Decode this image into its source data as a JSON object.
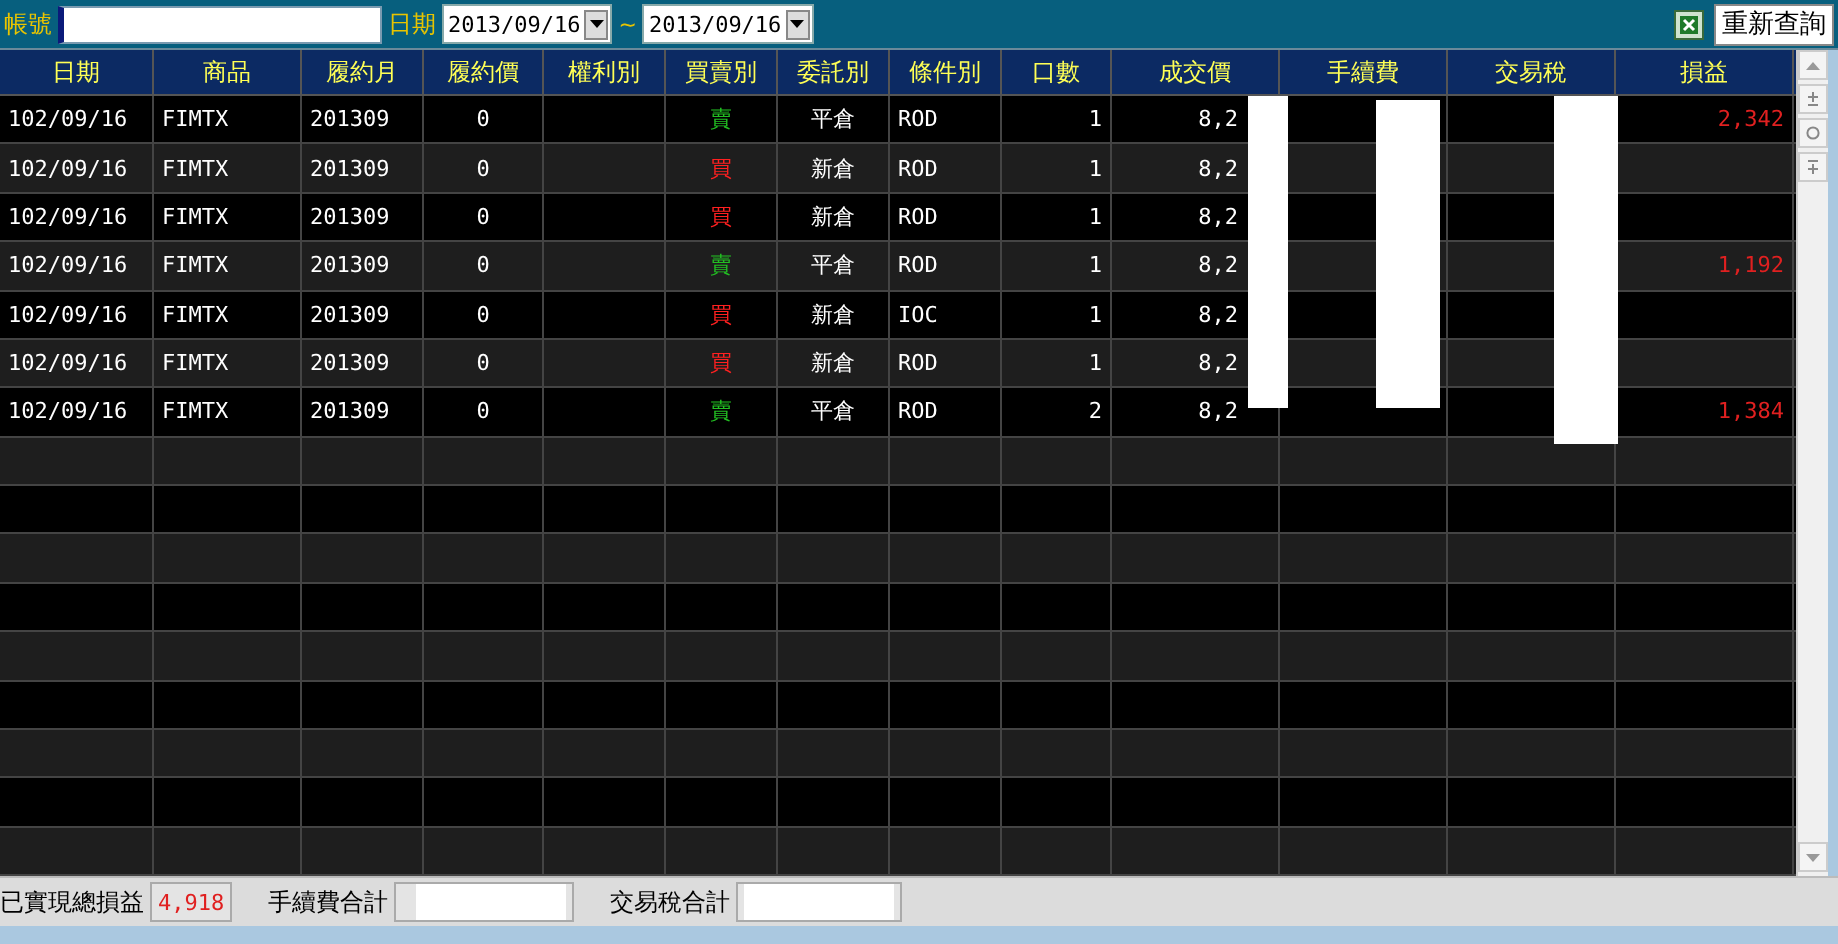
{
  "toolbar": {
    "account_label": "帳號",
    "date_label": "日期",
    "date_from": "2013/09/16",
    "date_separator": "~",
    "date_to": "2013/09/16",
    "requery_button": "重新查詢"
  },
  "table": {
    "columns": [
      "日期",
      "商品",
      "履約月",
      "履約價",
      "權利別",
      "買賣別",
      "委託別",
      "條件別",
      "口數",
      "成交價",
      "手續費",
      "交易稅",
      "損益"
    ],
    "rows": [
      {
        "date": "102/09/16",
        "product": "FIMTX",
        "month": "201309",
        "strike": "0",
        "right": "",
        "side": {
          "text": "賣",
          "kind": "sell"
        },
        "order": "平倉",
        "cond": "ROD",
        "qty": "1",
        "price": "8,2",
        "fee": "",
        "tax": "",
        "pnl": "2,342"
      },
      {
        "date": "102/09/16",
        "product": "FIMTX",
        "month": "201309",
        "strike": "0",
        "right": "",
        "side": {
          "text": "買",
          "kind": "buy"
        },
        "order": "新倉",
        "cond": "ROD",
        "qty": "1",
        "price": "8,2",
        "fee": "",
        "tax": "",
        "pnl": ""
      },
      {
        "date": "102/09/16",
        "product": "FIMTX",
        "month": "201309",
        "strike": "0",
        "right": "",
        "side": {
          "text": "買",
          "kind": "buy"
        },
        "order": "新倉",
        "cond": "ROD",
        "qty": "1",
        "price": "8,2",
        "fee": "",
        "tax": "",
        "pnl": ""
      },
      {
        "date": "102/09/16",
        "product": "FIMTX",
        "month": "201309",
        "strike": "0",
        "right": "",
        "side": {
          "text": "賣",
          "kind": "sell"
        },
        "order": "平倉",
        "cond": "ROD",
        "qty": "1",
        "price": "8,2",
        "fee": "",
        "tax": "",
        "pnl": "1,192"
      },
      {
        "date": "102/09/16",
        "product": "FIMTX",
        "month": "201309",
        "strike": "0",
        "right": "",
        "side": {
          "text": "買",
          "kind": "buy"
        },
        "order": "新倉",
        "cond": "IOC",
        "qty": "1",
        "price": "8,2",
        "fee": "",
        "tax": "",
        "pnl": ""
      },
      {
        "date": "102/09/16",
        "product": "FIMTX",
        "month": "201309",
        "strike": "0",
        "right": "",
        "side": {
          "text": "買",
          "kind": "buy"
        },
        "order": "新倉",
        "cond": "ROD",
        "qty": "1",
        "price": "8,2",
        "fee": "",
        "tax": "",
        "pnl": ""
      },
      {
        "date": "102/09/16",
        "product": "FIMTX",
        "month": "201309",
        "strike": "0",
        "right": "",
        "side": {
          "text": "賣",
          "kind": "sell"
        },
        "order": "平倉",
        "cond": "ROD",
        "qty": "2",
        "price": "8,2",
        "fee": "",
        "tax": "",
        "pnl": "1,384"
      }
    ]
  },
  "footer": {
    "realized_label": "已實現總損益",
    "realized_value": "4,918",
    "fee_label": "手續費合計",
    "tax_label": "交易稅合計"
  }
}
